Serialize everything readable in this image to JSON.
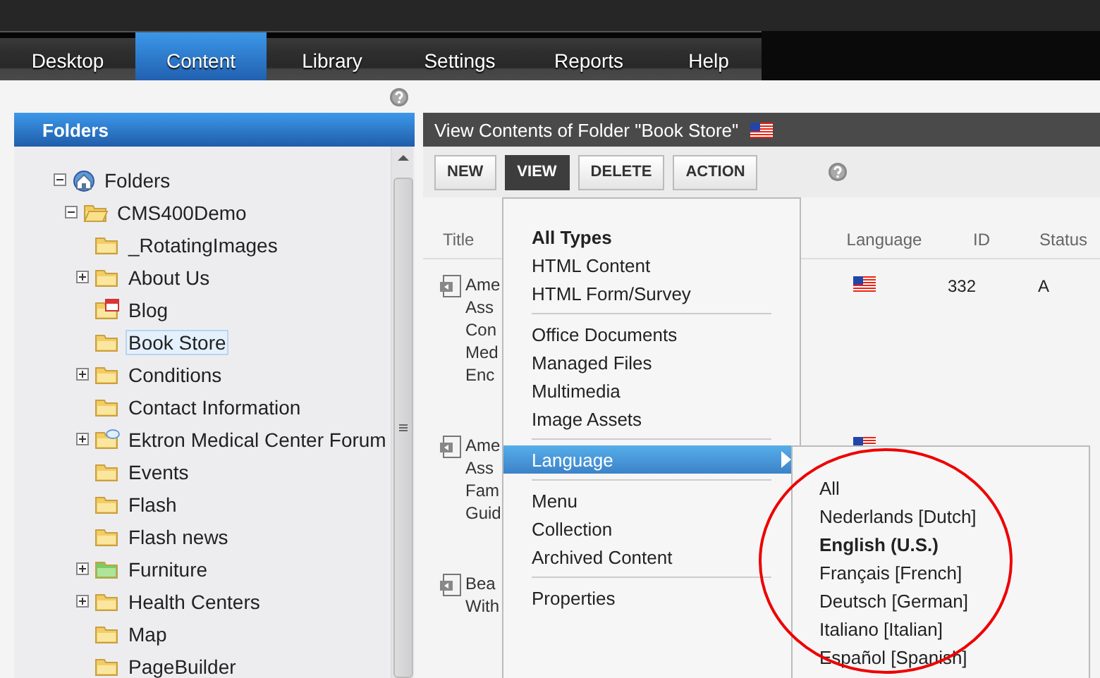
{
  "nav": {
    "tabs": [
      {
        "label": "Desktop",
        "selected": false
      },
      {
        "label": "Content",
        "selected": true
      },
      {
        "label": "Library",
        "selected": false
      },
      {
        "label": "Settings",
        "selected": false
      },
      {
        "label": "Reports",
        "selected": false
      },
      {
        "label": "Help",
        "selected": false
      }
    ]
  },
  "folders_panel": {
    "title": "Folders",
    "tree": [
      {
        "label": "Folders",
        "kind": "home",
        "expanded": true,
        "selected": false,
        "children": [
          {
            "label": "CMS400Demo",
            "kind": "open",
            "expanded": true,
            "selected": false,
            "children": [
              {
                "label": "_RotatingImages",
                "kind": "folder",
                "selected": false
              },
              {
                "label": "About Us",
                "kind": "folder",
                "expanded": false,
                "selected": false
              },
              {
                "label": "Blog",
                "kind": "blog",
                "selected": false
              },
              {
                "label": "Book Store",
                "kind": "folder",
                "selected": true
              },
              {
                "label": "Conditions",
                "kind": "folder",
                "expanded": false,
                "selected": false
              },
              {
                "label": "Contact Information",
                "kind": "folder",
                "selected": false
              },
              {
                "label": "Ektron Medical Center Forum",
                "kind": "forum",
                "expanded": false,
                "selected": false
              },
              {
                "label": "Events",
                "kind": "folder",
                "selected": false
              },
              {
                "label": "Flash",
                "kind": "folder",
                "selected": false
              },
              {
                "label": "Flash news",
                "kind": "folder",
                "selected": false
              },
              {
                "label": "Furniture",
                "kind": "green",
                "expanded": false,
                "selected": false
              },
              {
                "label": "Health Centers",
                "kind": "folder",
                "expanded": false,
                "selected": false
              },
              {
                "label": "Map",
                "kind": "folder",
                "selected": false
              },
              {
                "label": "PageBuilder",
                "kind": "folder",
                "selected": false
              }
            ]
          }
        ]
      }
    ]
  },
  "content_panel": {
    "title": "View Contents of Folder \"Book Store\"",
    "toolbar": [
      {
        "label": "NEW",
        "selected": false
      },
      {
        "label": "VIEW",
        "selected": true
      },
      {
        "label": "DELETE",
        "selected": false
      },
      {
        "label": "ACTION",
        "selected": false
      }
    ],
    "columns": [
      "Title",
      "Language",
      "ID",
      "Status"
    ],
    "rows": [
      {
        "title_lines": [
          "Ame",
          "Ass",
          "Con",
          "Med",
          "Enc"
        ],
        "language_flag": true,
        "id": "332",
        "status": "A"
      },
      {
        "title_lines": [
          "Ame",
          "Ass",
          "Fam",
          "Guid"
        ],
        "language_flag": true
      },
      {
        "title_lines": [
          "Bea",
          "With"
        ]
      }
    ]
  },
  "view_menu": {
    "items": [
      {
        "kind": "item",
        "label": "All Types",
        "selected": true,
        "highlighted": false,
        "submenu": false
      },
      {
        "kind": "item",
        "label": "HTML Content",
        "selected": false,
        "highlighted": false,
        "submenu": false
      },
      {
        "kind": "item",
        "label": "HTML Form/Survey",
        "selected": false,
        "highlighted": false,
        "submenu": false
      },
      {
        "kind": "separator"
      },
      {
        "kind": "item",
        "label": "Office Documents",
        "selected": false,
        "highlighted": false,
        "submenu": false
      },
      {
        "kind": "item",
        "label": "Managed Files",
        "selected": false,
        "highlighted": false,
        "submenu": false
      },
      {
        "kind": "item",
        "label": "Multimedia",
        "selected": false,
        "highlighted": false,
        "submenu": false
      },
      {
        "kind": "item",
        "label": "Image Assets",
        "selected": false,
        "highlighted": false,
        "submenu": false
      },
      {
        "kind": "separator"
      },
      {
        "kind": "item",
        "label": "Language",
        "selected": false,
        "highlighted": true,
        "submenu": true
      },
      {
        "kind": "separator"
      },
      {
        "kind": "item",
        "label": "Menu",
        "selected": false,
        "highlighted": false,
        "submenu": false
      },
      {
        "kind": "item",
        "label": "Collection",
        "selected": false,
        "highlighted": false,
        "submenu": false
      },
      {
        "kind": "item",
        "label": "Archived Content",
        "selected": false,
        "highlighted": false,
        "submenu": false
      },
      {
        "kind": "separator"
      },
      {
        "kind": "item",
        "label": "Properties",
        "selected": false,
        "highlighted": false,
        "submenu": false
      }
    ]
  },
  "language_menu": {
    "items": [
      {
        "label": "All",
        "selected": false
      },
      {
        "label": "Nederlands [Dutch]",
        "selected": false
      },
      {
        "label": "English (U.S.)",
        "selected": true
      },
      {
        "label": "Français [French]",
        "selected": false
      },
      {
        "label": "Deutsch [German]",
        "selected": false
      },
      {
        "label": "Italiano [Italian]",
        "selected": false
      },
      {
        "label": "Español [Spanish]",
        "selected": false
      }
    ]
  }
}
